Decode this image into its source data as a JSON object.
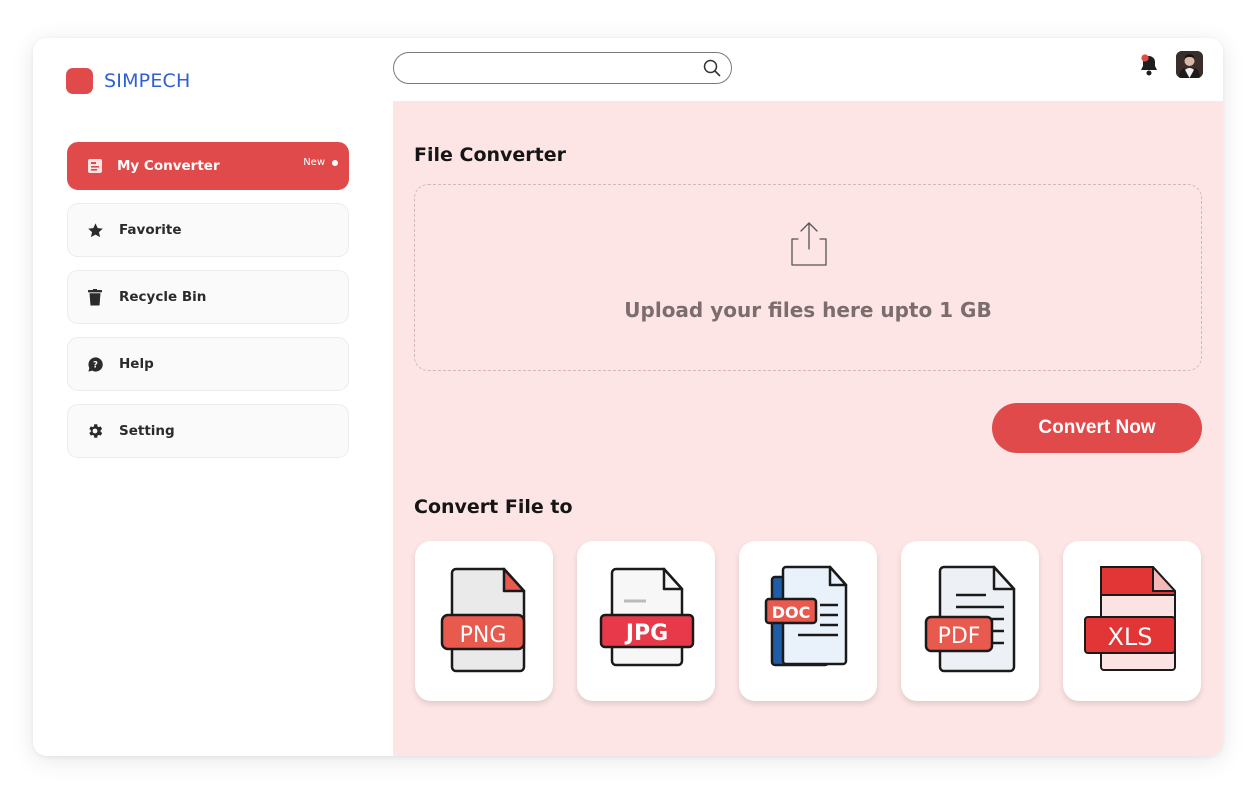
{
  "brand": {
    "name": "SIMPECH",
    "accent": "#e04a4a",
    "name_color": "#2f5fd0"
  },
  "search": {
    "placeholder": "",
    "value": "",
    "icon": "search-icon"
  },
  "header": {
    "notification_icon": "bell-icon",
    "avatar": "user-avatar"
  },
  "sidebar": {
    "items": [
      {
        "label": "My Converter",
        "icon": "converter-icon",
        "active": true,
        "badge": "New"
      },
      {
        "label": "Favorite",
        "icon": "star-icon"
      },
      {
        "label": "Recycle Bin",
        "icon": "trash-icon"
      },
      {
        "label": "Help",
        "icon": "help-bubble-icon"
      },
      {
        "label": "Setting",
        "icon": "gear-icon"
      }
    ]
  },
  "main": {
    "title": "File Converter",
    "upload_text": "Upload your files here upto 1 GB",
    "upload_icon": "upload-icon",
    "convert_button": "Convert Now",
    "convert_to_title": "Convert File to",
    "formats": [
      {
        "label": "PNG",
        "icon": "png-file-icon"
      },
      {
        "label": "JPG",
        "icon": "jpg-file-icon"
      },
      {
        "label": "DOC",
        "icon": "doc-file-icon"
      },
      {
        "label": "PDF",
        "icon": "pdf-file-icon"
      },
      {
        "label": "XLS",
        "icon": "xls-file-icon"
      }
    ],
    "background": "#fde5e5"
  }
}
